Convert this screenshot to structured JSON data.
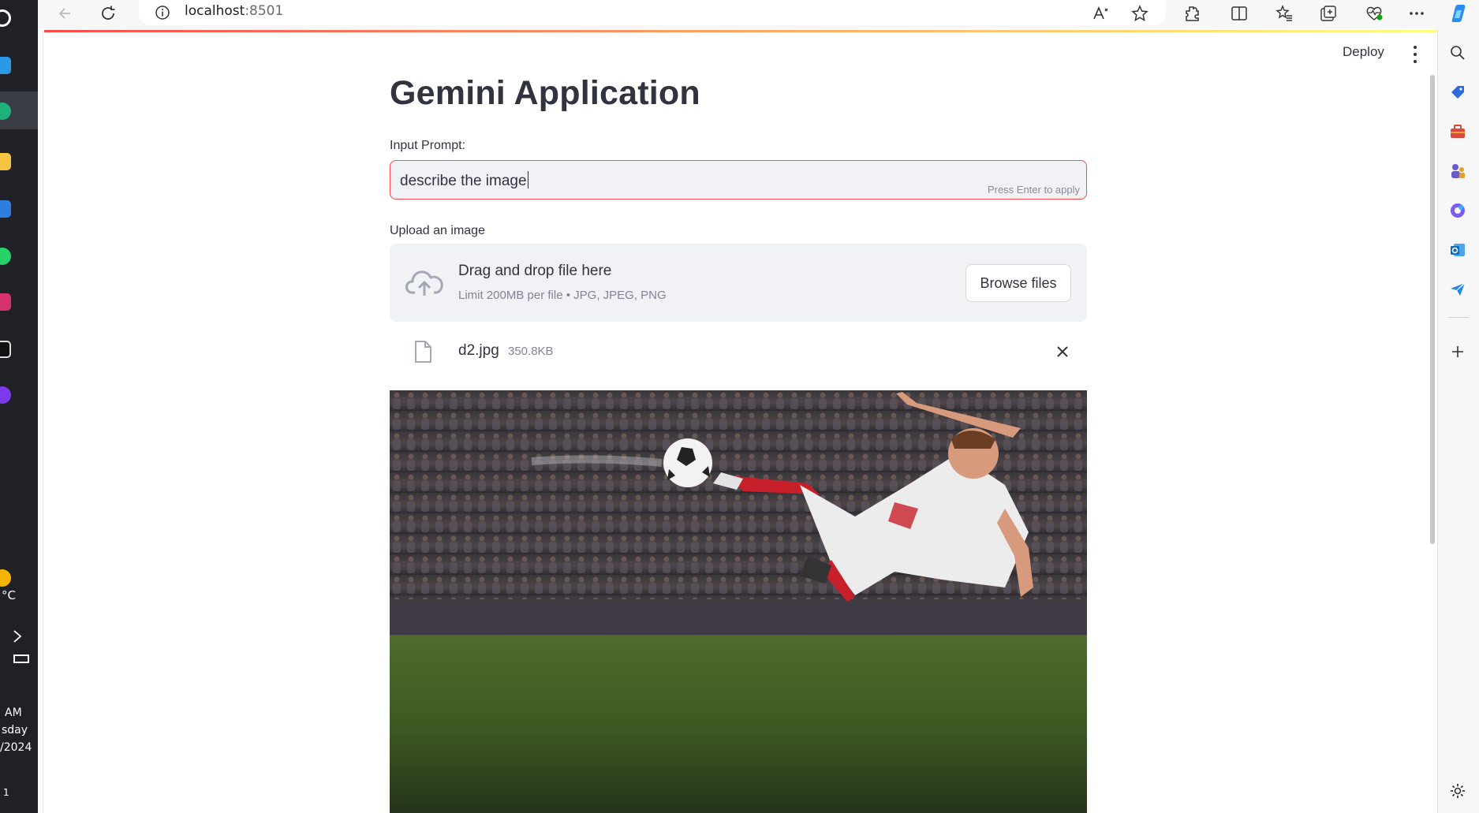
{
  "browser": {
    "url_host": "localhost",
    "url_port": ":8501"
  },
  "app": {
    "header": {
      "deploy_label": "Deploy"
    },
    "title": "Gemini Application",
    "prompt": {
      "label": "Input Prompt:",
      "value": "describe the image",
      "hint": "Press Enter to apply"
    },
    "uploader": {
      "label": "Upload an image",
      "drop_title": "Drag and drop file here",
      "drop_limits": "Limit 200MB per file • JPG, JPEG, PNG",
      "browse_label": "Browse files"
    },
    "uploaded_file": {
      "name": "d2.jpg",
      "size": "350.8KB"
    },
    "preview": {
      "subject": "soccer player performing a bicycle kick in a stadium"
    }
  },
  "taskbar": {
    "weather_temp": "°C",
    "time_fragment": "AM",
    "day_fragment": "sday",
    "date_fragment": "/2024",
    "notification_count": "1"
  },
  "colors": {
    "accent": "#ff4b4b",
    "input_bg": "#f0f2f6",
    "text": "#31333f",
    "muted": "#808495"
  }
}
